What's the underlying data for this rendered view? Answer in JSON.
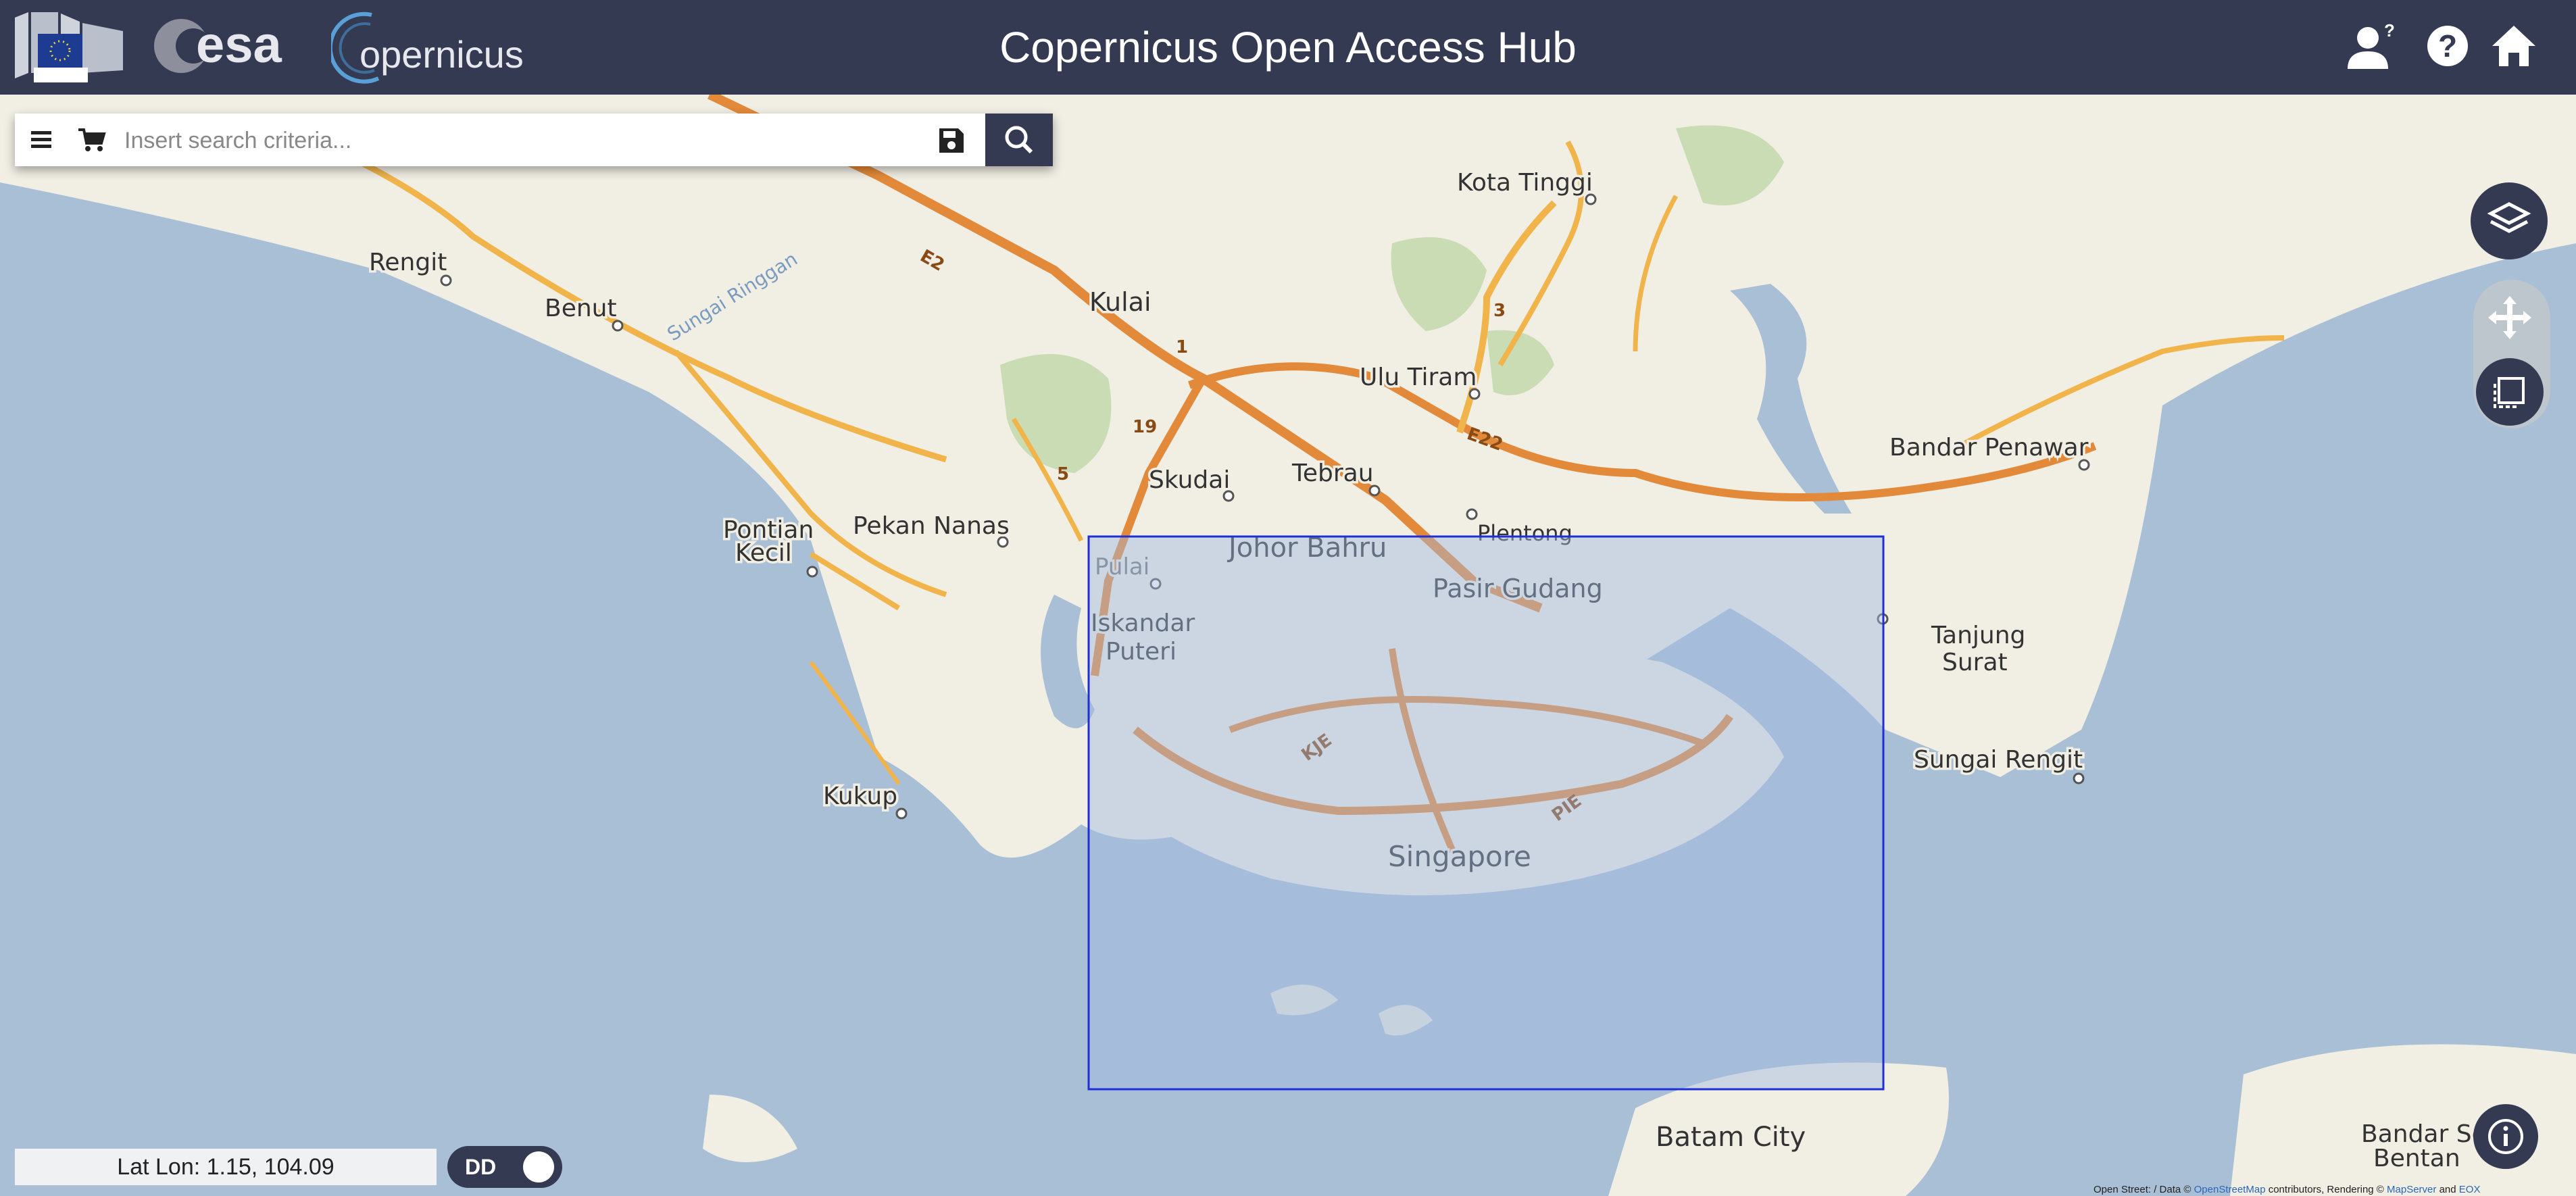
{
  "header": {
    "title": "Copernicus Open Access Hub",
    "logos": {
      "eu": "European Commission",
      "esa": "esa",
      "copernicus": "opernicus"
    },
    "icons": [
      "user-help-icon",
      "help-icon",
      "home-icon"
    ]
  },
  "search": {
    "placeholder": "Insert search criteria...",
    "value": "",
    "icons": [
      "menu-icon",
      "cart-icon",
      "save-icon",
      "search-icon"
    ]
  },
  "map": {
    "labels": {
      "kota_tinggi": "Kota Tinggi",
      "rengit": "Rengit",
      "benut": "Benut",
      "sungai_ringgan": "Sungai Ringgan",
      "kulai": "Kulai",
      "ulu_tiram": "Ulu Tiram",
      "bandar_penawar": "Bandar Penawar",
      "skudai": "Skudai",
      "tebrau": "Tebrau",
      "plentong": "Plentong",
      "pontian": "Pontian",
      "kecil": "Kecil",
      "pekan_nanas": "Pekan Nanas",
      "johor_bahru": "Johor Bahru",
      "pulai": "Pulai",
      "pasir_gudang": "Pasir Gudang",
      "iskandar": "Iskandar",
      "puteri": "Puteri",
      "tanjung": "Tanjung",
      "surat": "Surat",
      "sungai_rengit": "Sungai Rengit",
      "kukup": "Kukup",
      "singapore": "Singapore",
      "batam_city": "Batam City",
      "bandar_se": "Bandar Se",
      "bentan": "Bentan",
      "e2": "E2",
      "e22": "E22",
      "r1": "1",
      "r3": "3",
      "r5": "5",
      "r19": "19",
      "kje": "KJE",
      "pie": "PIE"
    },
    "selection_color": "#1f2ed6",
    "controls": [
      "layers-icon",
      "pan-icon",
      "area-select-icon",
      "info-icon"
    ]
  },
  "footer": {
    "latlon": "Lat Lon: 1.15, 104.09",
    "format_toggle": "DD",
    "attribution_prefix": "Open Street: / Data ©",
    "attribution_link1": "OpenStreetMap",
    "attribution_mid": "contributors, Rendering ©",
    "attribution_link2": "MapServer",
    "attribution_and": "and",
    "attribution_link3": "EOX"
  },
  "colors": {
    "header_bg": "#343a52",
    "sea": "#a9bfd6",
    "land": "#f1eee4",
    "motorway": "#e3893a",
    "trunk": "#f0b44a"
  }
}
